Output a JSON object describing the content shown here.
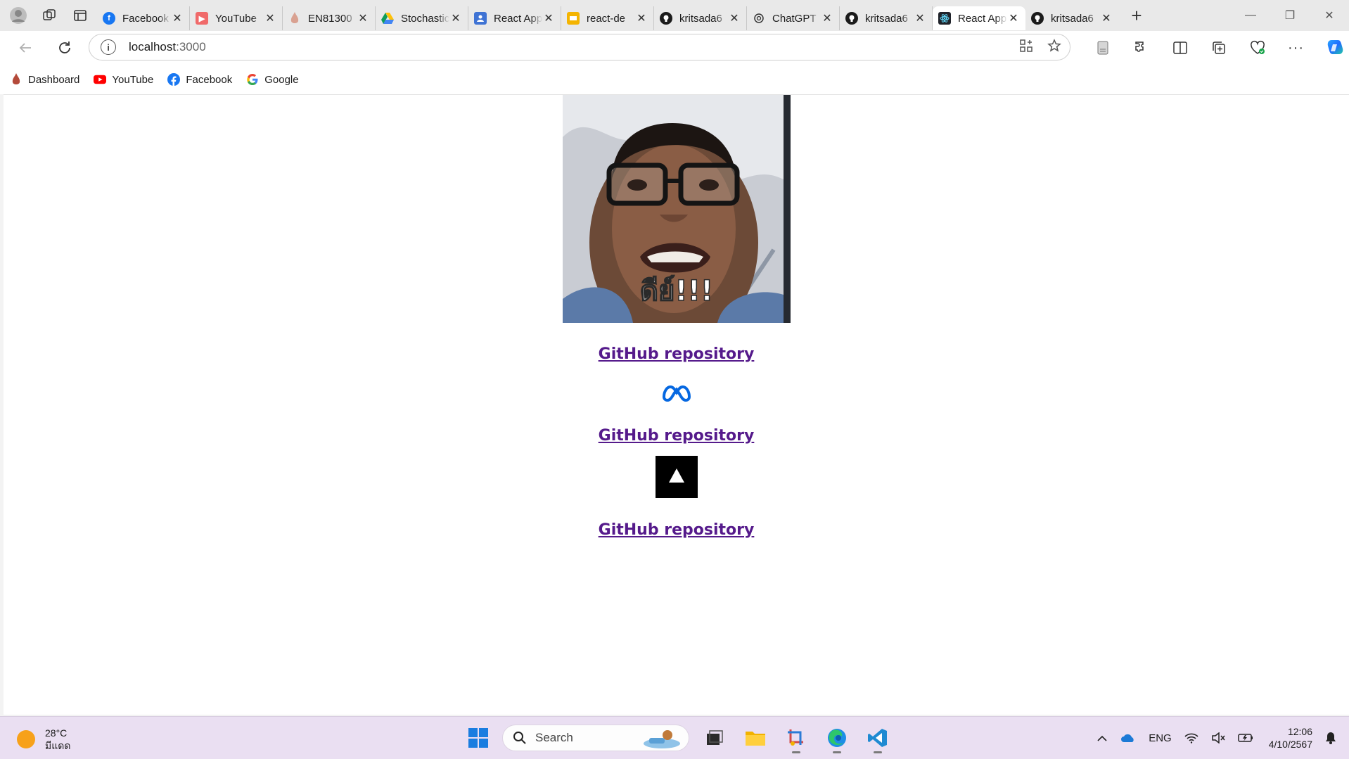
{
  "tabs": [
    {
      "label": "Facebook",
      "icon": "facebook-icon",
      "color": "#1877f2",
      "active": false
    },
    {
      "label": "YouTube",
      "icon": "youtube-icon",
      "color": "#ff0000",
      "active": false
    },
    {
      "label": "EN81300",
      "icon": "flame-icon",
      "color": "#c0392b",
      "active": false
    },
    {
      "label": "Stochastic",
      "icon": "google-drive-icon",
      "color": "#0f9d58",
      "active": false
    },
    {
      "label": "React App",
      "icon": "user-card-icon",
      "color": "#4a7bd8",
      "active": false
    },
    {
      "label": "react-de",
      "icon": "slides-icon",
      "color": "#f4b400",
      "active": false
    },
    {
      "label": "kritsada6",
      "icon": "github-icon",
      "color": "#1b1b1b",
      "active": false
    },
    {
      "label": "ChatGPT",
      "icon": "chatgpt-icon",
      "color": "#1b1b1b",
      "active": false
    },
    {
      "label": "kritsada6",
      "icon": "github-icon",
      "color": "#1b1b1b",
      "active": false
    },
    {
      "label": "React App",
      "icon": "react-icon",
      "color": "#61dafb",
      "active": true
    },
    {
      "label": "kritsada6",
      "icon": "github-icon",
      "color": "#1b1b1b",
      "active": false
    }
  ],
  "address": {
    "host": "localhost",
    "port": ":3000"
  },
  "bookmarks": [
    {
      "label": "Dashboard",
      "icon": "flame-icon"
    },
    {
      "label": "YouTube",
      "icon": "youtube-icon"
    },
    {
      "label": "Facebook",
      "icon": "facebook-icon"
    },
    {
      "label": "Google",
      "icon": "google-icon"
    }
  ],
  "page": {
    "hero_caption": "ดีย์!!!",
    "links": [
      {
        "label": "GitHub repository"
      },
      {
        "label": "GitHub repository"
      },
      {
        "label": "GitHub repository"
      }
    ],
    "logos": [
      "meta-logo-icon",
      "vercel-logo-icon"
    ]
  },
  "taskbar": {
    "weather_temp": "28°C",
    "weather_desc": "มีแดด",
    "search_label": "Search",
    "language": "ENG",
    "time": "12:06",
    "date": "4/10/2567"
  }
}
